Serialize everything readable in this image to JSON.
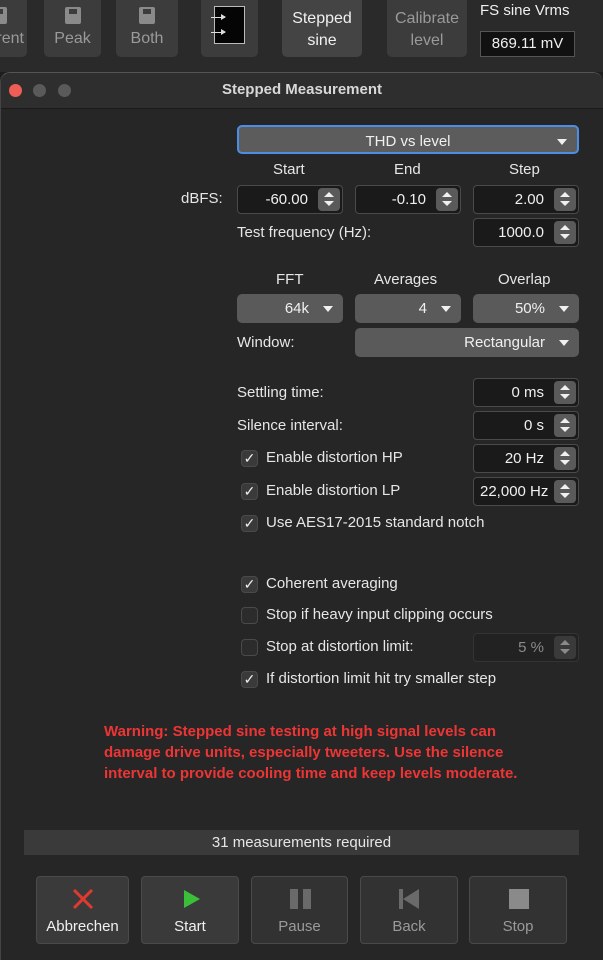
{
  "toolbar": {
    "buttons": [
      {
        "label": "rent"
      },
      {
        "label": "Peak"
      },
      {
        "label": "Both"
      }
    ],
    "stepped_sine_label": "Stepped\nsine",
    "stepped_sine_line1": "Stepped",
    "stepped_sine_line2": "sine",
    "calibrate_line1": "Calibrate",
    "calibrate_line2": "level",
    "fs_title": "FS sine Vrms",
    "fs_value": "869.11 mV"
  },
  "window": {
    "title": "Stepped Measurement"
  },
  "form": {
    "measurement_type": "THD vs level",
    "col_start": "Start",
    "col_end": "End",
    "col_step": "Step",
    "dbfs_label": "dBFS:",
    "start_value": "-60.00",
    "end_value": "-0.10",
    "step_value": "2.00",
    "test_freq_label": "Test frequency (Hz):",
    "test_freq_value": "1000.0",
    "fft_label": "FFT",
    "averages_label": "Averages",
    "overlap_label": "Overlap",
    "fft_value": "64k",
    "averages_value": "4",
    "overlap_value": "50%",
    "window_label": "Window:",
    "window_value": "Rectangular",
    "settling_label": "Settling time:",
    "settling_value": "0 ms",
    "silence_label": "Silence interval:",
    "silence_value": "0 s",
    "dist_hp_label": "Enable distortion HP",
    "dist_hp_value": "20 Hz",
    "dist_lp_label": "Enable distortion LP",
    "dist_lp_value": "22,000 Hz",
    "aes_label": "Use AES17-2015 standard notch",
    "coherent_label": "Coherent averaging",
    "clipping_label": "Stop if heavy input clipping occurs",
    "dist_limit_label": "Stop at distortion limit:",
    "dist_limit_value": "5 %",
    "smaller_step_label": "If distortion limit hit try smaller step"
  },
  "checkboxes": {
    "dist_hp": true,
    "dist_lp": true,
    "aes": true,
    "coherent": true,
    "clipping": false,
    "dist_limit": false,
    "smaller_step": true
  },
  "warning": "Warning: Stepped sine testing at high signal levels can damage drive units, especially tweeters. Use the silence interval to provide cooling time and keep levels moderate.",
  "status": "31 measurements required",
  "actions": {
    "cancel": "Abbrechen",
    "start": "Start",
    "pause": "Pause",
    "back": "Back",
    "stop": "Stop"
  },
  "colors": {
    "warning": "#ee3535",
    "close_icon": "#e03a2f",
    "start_icon": "#3bbf3b",
    "focus": "#4a8ee8"
  }
}
